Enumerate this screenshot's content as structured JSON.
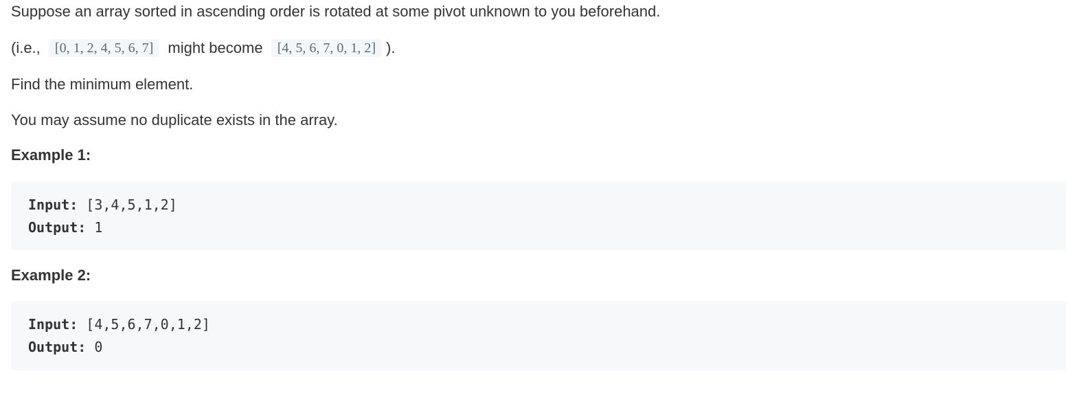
{
  "problem": {
    "intro": "Suppose an array sorted in ascending order is rotated at some pivot unknown to you beforehand.",
    "example_line": {
      "prefix": "(i.e.,",
      "array_before": "[0, 1, 2, 4, 5, 6, 7]",
      "middle": "might become",
      "array_after": "[4, 5, 6, 7, 0, 1, 2]",
      "suffix": ")."
    },
    "task": "Find the minimum element.",
    "assumption": "You may assume no duplicate exists in the array."
  },
  "examples": [
    {
      "heading": "Example 1:",
      "input_label": "Input:",
      "input_value": " [3,4,5,1,2]",
      "output_label": "Output:",
      "output_value": " 1"
    },
    {
      "heading": "Example 2:",
      "input_label": "Input:",
      "input_value": " [4,5,6,7,0,1,2]",
      "output_label": "Output:",
      "output_value": " 0"
    }
  ]
}
